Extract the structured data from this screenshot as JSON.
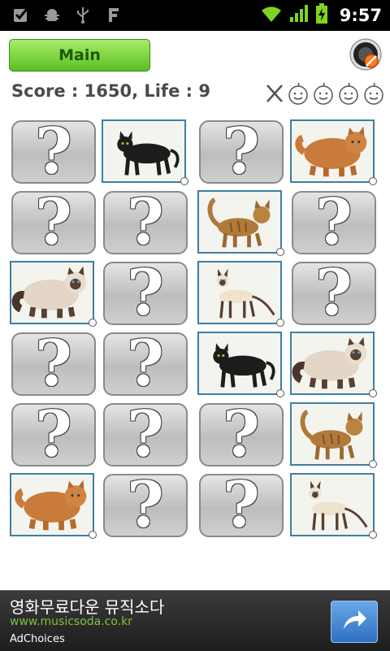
{
  "status_bar": {
    "time": "9:57",
    "left_icons": [
      "checkbox-icon",
      "android-debug-icon",
      "usb-icon",
      "f-app-icon"
    ],
    "right_icons": [
      "wifi-icon",
      "signal-icon",
      "battery-charging-icon"
    ]
  },
  "header": {
    "main_label": "Main",
    "score_text": "Score : 1650, Life : 9",
    "sound_icon": "sound-off-icon",
    "life_icons": [
      "x-mark-icon",
      "face-icon",
      "face-icon",
      "face-icon",
      "face-icon"
    ]
  },
  "board": {
    "rows": 6,
    "cols": 4,
    "cards": [
      [
        "hidden",
        "black-cat",
        "hidden",
        "persian-cat"
      ],
      [
        "hidden",
        "hidden",
        "tabby-cat",
        "hidden"
      ],
      [
        "himalayan-cat",
        "hidden",
        "siamese-cat",
        "hidden"
      ],
      [
        "hidden",
        "hidden",
        "black-cat",
        "himalayan-cat"
      ],
      [
        "hidden",
        "hidden",
        "hidden",
        "tabby-cat"
      ],
      [
        "persian-cat",
        "hidden",
        "hidden",
        "siamese-cat"
      ]
    ],
    "hidden_symbol": "?"
  },
  "ad": {
    "title": "영화무료다운 뮤직소다",
    "url": "www.musicsoda.co.kr",
    "choices": "AdChoices",
    "arrow_icon": "share-arrow-icon"
  },
  "colors": {
    "main_button": "#5bbf23",
    "card_border_open": "#3f7fa3",
    "ad_url": "#7dc242",
    "ad_button": "#2f6fc1"
  }
}
